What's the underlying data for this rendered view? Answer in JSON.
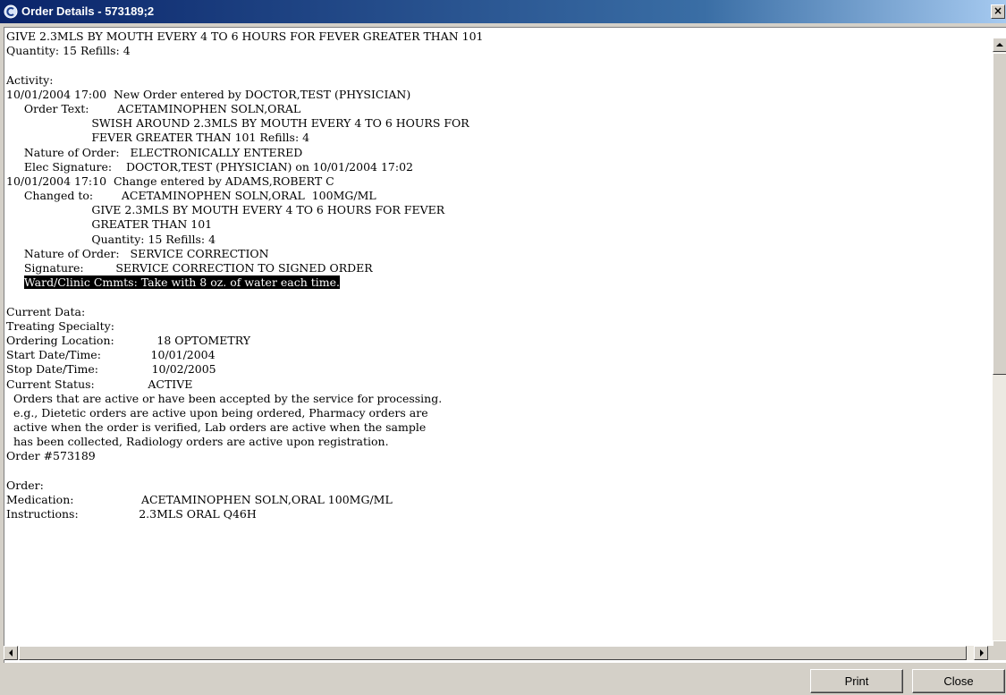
{
  "window": {
    "title": "Order Details - 573189;2",
    "close_glyph": "×"
  },
  "content_lines": [
    "GIVE 2.3MLS BY MOUTH EVERY 4 TO 6 HOURS FOR FEVER GREATER THAN 101",
    "Quantity: 15 Refills: 4",
    "",
    "Activity:",
    "10/01/2004 17:00  New Order entered by DOCTOR,TEST (PHYSICIAN)",
    "     Order Text:        ACETAMINOPHEN SOLN,ORAL",
    "                        SWISH AROUND 2.3MLS BY MOUTH EVERY 4 TO 6 HOURS FOR",
    "                        FEVER GREATER THAN 101 Refills: 4",
    "     Nature of Order:   ELECTRONICALLY ENTERED",
    "     Elec Signature:    DOCTOR,TEST (PHYSICIAN) on 10/01/2004 17:02",
    "10/01/2004 17:10  Change entered by ADAMS,ROBERT C",
    "     Changed to:        ACETAMINOPHEN SOLN,ORAL  100MG/ML",
    "                        GIVE 2.3MLS BY MOUTH EVERY 4 TO 6 HOURS FOR FEVER",
    "                        GREATER THAN 101",
    "                        Quantity: 15 Refills: 4",
    "     Nature of Order:   SERVICE CORRECTION",
    "     Signature:         SERVICE CORRECTION TO SIGNED ORDER",
    "",
    "",
    "Current Data:",
    "Treating Specialty:",
    "Ordering Location:            18 OPTOMETRY",
    "Start Date/Time:              10/01/2004",
    "Stop Date/Time:               10/02/2005",
    "Current Status:               ACTIVE",
    "  Orders that are active or have been accepted by the service for processing.",
    "  e.g., Dietetic orders are active upon being ordered, Pharmacy orders are",
    "  active when the order is verified, Lab orders are active when the sample",
    "  has been collected, Radiology orders are active upon registration.",
    "Order #573189",
    "",
    "Order:",
    "Medication:                   ACETAMINOPHEN SOLN,ORAL 100MG/ML",
    "Instructions:                 2.3MLS ORAL Q46H"
  ],
  "highlight_line": {
    "indent": "     ",
    "text": "Ward/Clinic Cmmts: Take with 8 oz. of water each time."
  },
  "buttons": {
    "print": "Print",
    "close": "Close"
  }
}
